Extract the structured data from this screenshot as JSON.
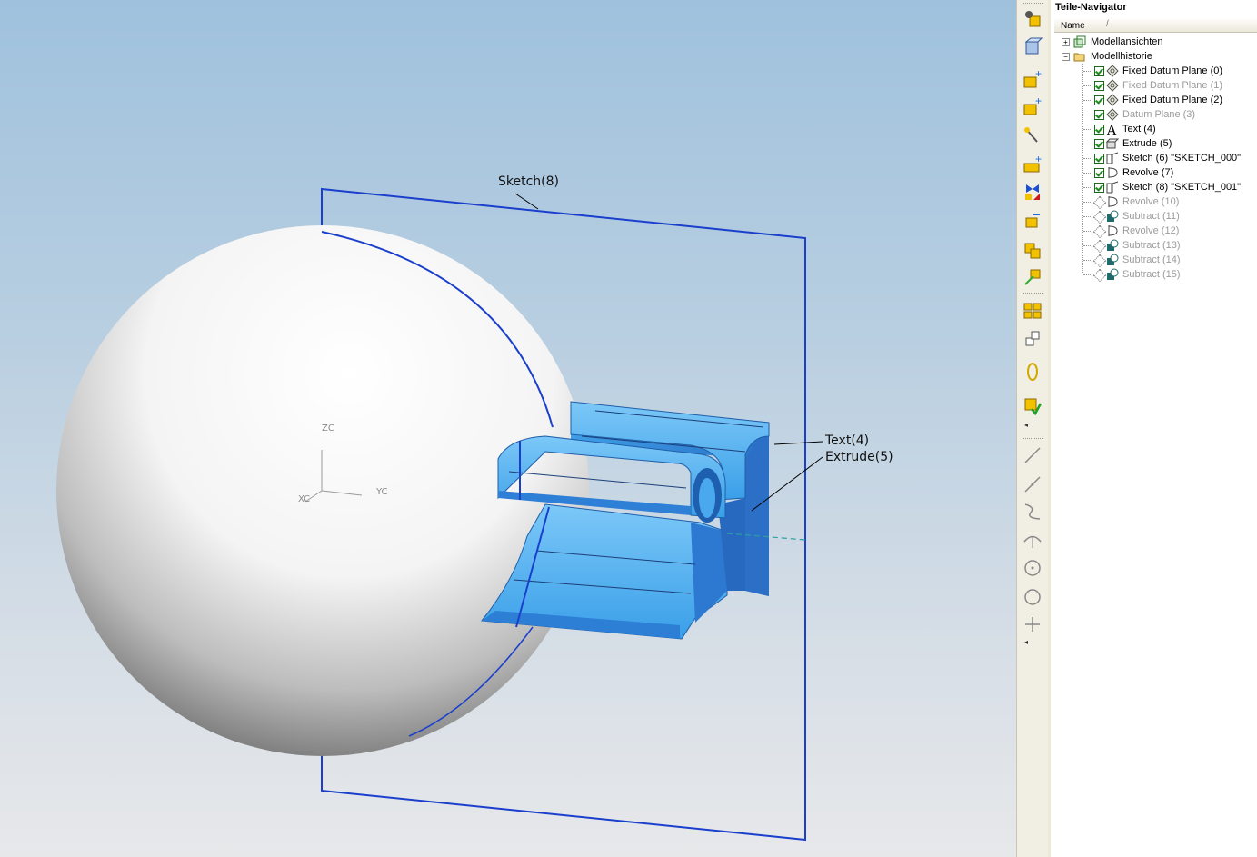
{
  "viewport": {
    "labels": {
      "sketch8": "Sketch(8)",
      "text4": "Text(4)",
      "extrude5": "Extrude(5)"
    },
    "axes": {
      "z": "ZC",
      "y": "YC",
      "x": "XC"
    },
    "colors": {
      "sketch_frame": "#1a3fcc",
      "solid_blue": "#3fa6ec",
      "solid_dark": "#2a6fc9",
      "sphere": "#ffffff"
    }
  },
  "toolbar": {
    "icons": [
      "show-hide-icon",
      "view-cube-icon",
      "new-layer-icon",
      "add-object-icon",
      "wizard-icon",
      "add-body-icon",
      "mirror-icon",
      "move-icon",
      "copy-icon",
      "transform-icon",
      "group-icon",
      "edit-icon",
      "link-icon",
      "check-icon"
    ],
    "sketch_icons": [
      "line-icon",
      "line-ortho-icon",
      "spline-icon",
      "arc-icon",
      "point-circle-icon",
      "circle-icon",
      "cross-point-icon"
    ]
  },
  "navigator": {
    "title": "Teile-Navigator",
    "column_name": "Name",
    "column_sort": "/",
    "groups": [
      {
        "label": "Modellansichten",
        "expander": "+"
      },
      {
        "label": "Modellhistorie",
        "expander": "−"
      }
    ],
    "items": [
      {
        "label": "Fixed Datum Plane (0)",
        "state": "checked",
        "muted": false,
        "icon": "datum-plane-icon"
      },
      {
        "label": "Fixed Datum Plane (1)",
        "state": "checked",
        "muted": true,
        "icon": "datum-plane-icon"
      },
      {
        "label": "Fixed Datum Plane (2)",
        "state": "checked",
        "muted": false,
        "icon": "datum-plane-icon"
      },
      {
        "label": "Datum Plane (3)",
        "state": "checked",
        "muted": true,
        "icon": "datum-plane-icon"
      },
      {
        "label": "Text (4)",
        "state": "checked",
        "muted": false,
        "icon": "text-icon"
      },
      {
        "label": "Extrude (5)",
        "state": "checked",
        "muted": false,
        "icon": "extrude-icon"
      },
      {
        "label": "Sketch (6) \"SKETCH_000\"",
        "state": "checked",
        "muted": false,
        "icon": "sketch-icon"
      },
      {
        "label": "Revolve (7)",
        "state": "checked",
        "muted": false,
        "icon": "revolve-icon"
      },
      {
        "label": "Sketch (8) \"SKETCH_001\"",
        "state": "checked",
        "muted": false,
        "icon": "sketch-icon"
      },
      {
        "label": "Revolve (10)",
        "state": "unchecked",
        "muted": true,
        "icon": "revolve-icon"
      },
      {
        "label": "Subtract (11)",
        "state": "unchecked",
        "muted": true,
        "icon": "subtract-icon"
      },
      {
        "label": "Revolve (12)",
        "state": "unchecked",
        "muted": true,
        "icon": "revolve-icon"
      },
      {
        "label": "Subtract (13)",
        "state": "unchecked",
        "muted": true,
        "icon": "subtract-icon"
      },
      {
        "label": "Subtract (14)",
        "state": "unchecked",
        "muted": true,
        "icon": "subtract-icon"
      },
      {
        "label": "Subtract (15)",
        "state": "unchecked",
        "muted": true,
        "icon": "subtract-icon"
      }
    ]
  }
}
